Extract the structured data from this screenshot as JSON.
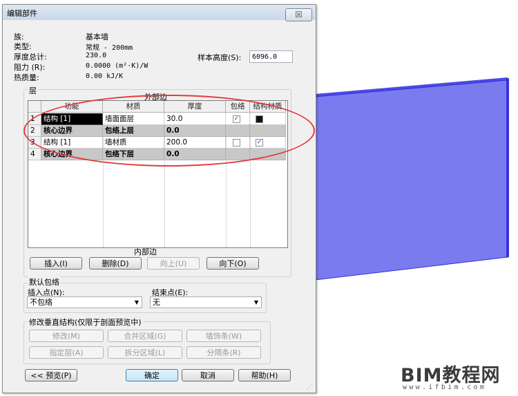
{
  "dialog": {
    "title": "编辑部件",
    "close_label": "☒"
  },
  "properties": {
    "family_label": "族:",
    "family_value": "基本墙",
    "type_label": "类型:",
    "type_value": "常规 - 200mm",
    "thickness_label": "厚度总计:",
    "thickness_value": "230.0",
    "resistance_label": "阻力 (R):",
    "resistance_value": "0.0000 (m²·K)/W",
    "thermal_label": "热质量:",
    "thermal_value": "0.00 kJ/K",
    "sample_height_label": "样本高度(S):",
    "sample_height_value": "6096.0"
  },
  "layers": {
    "group_label": "层",
    "exterior_label": "外部边",
    "interior_label": "内部边",
    "columns": [
      "",
      "功能",
      "材质",
      "厚度",
      "包络",
      "结构材质"
    ],
    "rows": [
      {
        "num": "1",
        "function": "结构 [1]",
        "material": "墙面面层",
        "thickness": "30.0",
        "wrap": true,
        "structural": false,
        "style": "selected"
      },
      {
        "num": "2",
        "function": "核心边界",
        "material": "包络上层",
        "thickness": "0.0",
        "style": "core"
      },
      {
        "num": "3",
        "function": "结构 [1]",
        "material": "墙材质",
        "thickness": "200.0",
        "wrap": false,
        "structural": true,
        "style": "normal"
      },
      {
        "num": "4",
        "function": "核心边界",
        "material": "包络下层",
        "thickness": "0.0",
        "style": "core"
      }
    ],
    "buttons": {
      "insert": "插入(I)",
      "delete": "删除(D)",
      "up": "向上(U)",
      "down": "向下(O)"
    }
  },
  "default_wrap": {
    "group_label": "默认包络",
    "insert_label": "插入点(N):",
    "insert_value": "不包络",
    "end_label": "结束点(E):",
    "end_value": "无"
  },
  "vertical": {
    "group_label": "修改垂直结构(仅限于剖面预览中)",
    "modify": "修改(M)",
    "merge": "合并区域(G)",
    "sweeps": "墙饰条(W)",
    "assign": "指定层(A)",
    "split": "拆分区域(L)",
    "reveals": "分隔条(R)"
  },
  "footer": {
    "preview": "<< 预览(P)",
    "ok": "确定",
    "cancel": "取消",
    "help": "帮助(H)"
  },
  "logo": {
    "text": "BIM教程网",
    "sub": "www.ifbim.com"
  },
  "colors": {
    "wall_face": "#7b7bf0",
    "wall_edge": "#2f2fd6",
    "annotation": "#e23b3b",
    "selected_row": "#000000",
    "core_row": "#c8c8c8"
  }
}
